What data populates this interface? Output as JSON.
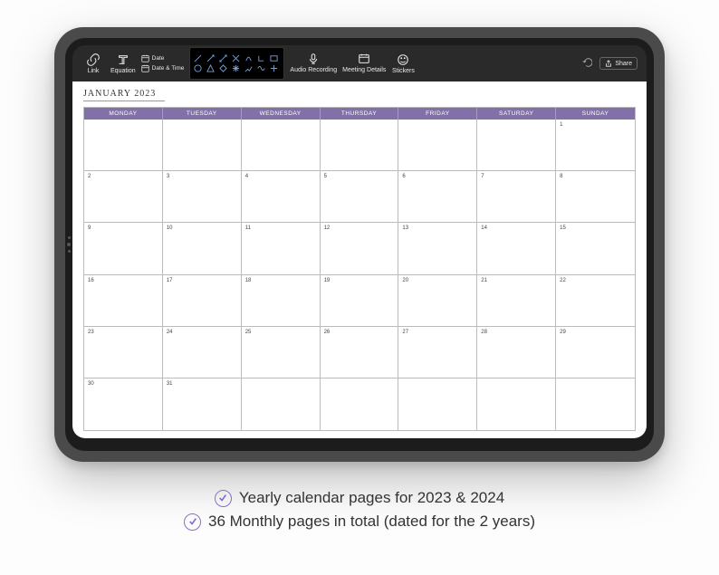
{
  "toolbar": {
    "link_label": "Link",
    "equation_label": "Equation",
    "date_label": "Date",
    "datetime_label": "Date & Time",
    "audio_label": "Audio Recording",
    "meeting_label": "Meeting Details",
    "stickers_label": "Stickers",
    "share_label": "Share"
  },
  "calendar": {
    "month_title": "JANUARY 2023",
    "weekdays": [
      "MONDAY",
      "TUESDAY",
      "WEDNESDAY",
      "THURSDAY",
      "FRIDAY",
      "SATURDAY",
      "SUNDAY"
    ],
    "days": [
      "",
      "",
      "",
      "",
      "",
      "",
      "1",
      "2",
      "3",
      "4",
      "5",
      "6",
      "7",
      "8",
      "9",
      "10",
      "11",
      "12",
      "13",
      "14",
      "15",
      "16",
      "17",
      "18",
      "19",
      "20",
      "21",
      "22",
      "23",
      "24",
      "25",
      "26",
      "27",
      "28",
      "29",
      "30",
      "31",
      "",
      "",
      "",
      "",
      ""
    ],
    "accent_color": "#8270a8"
  },
  "captions": {
    "line1": "Yearly calendar pages for 2023 & 2024",
    "line2": "36 Monthly pages in total (dated for the 2 years)"
  }
}
